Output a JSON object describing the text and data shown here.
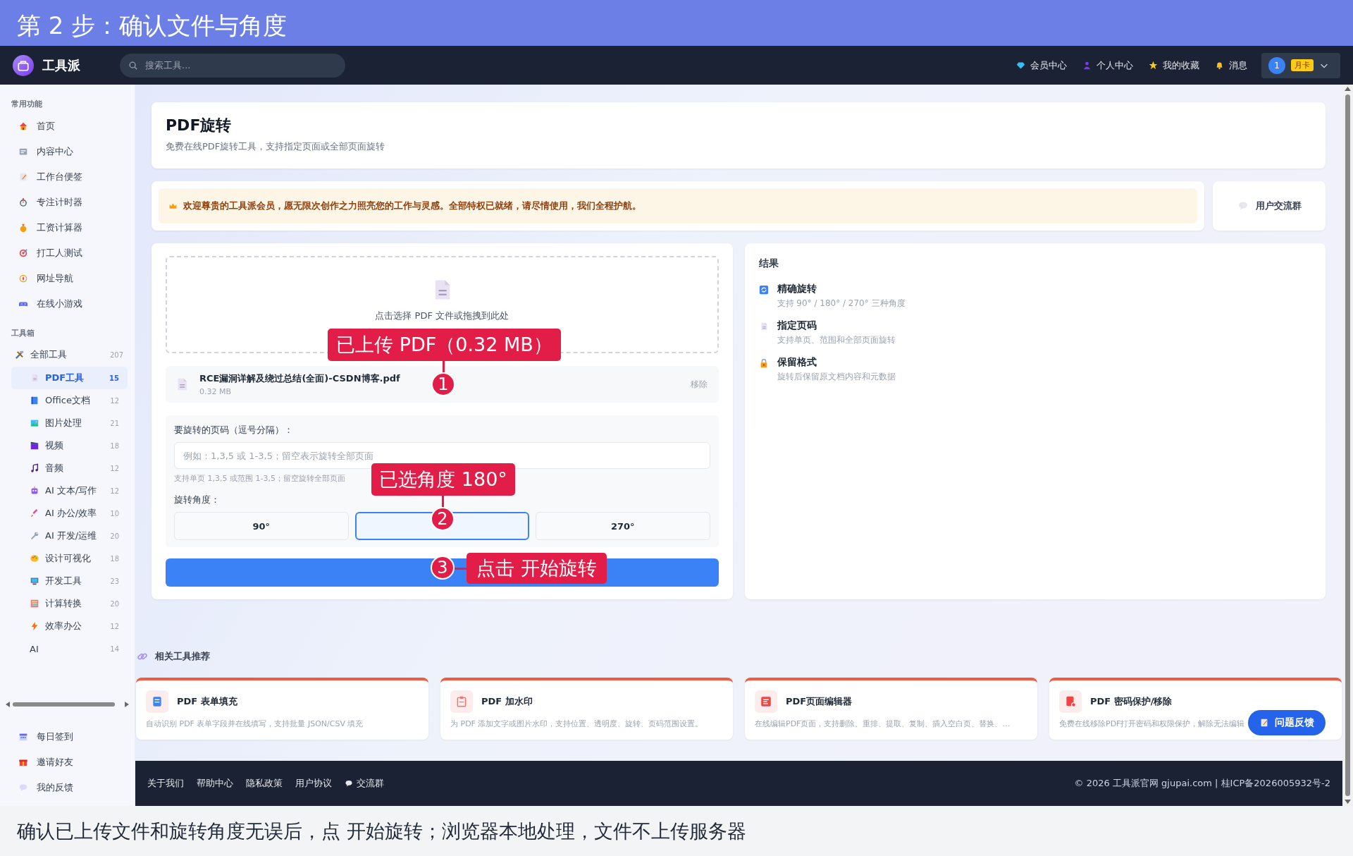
{
  "step_banner": {
    "title": "第 2 步：确认文件与角度"
  },
  "header": {
    "brand": "工具派",
    "search": {
      "placeholder": "搜索工具..."
    },
    "nav": [
      {
        "label": "会员中心"
      },
      {
        "label": "个人中心"
      },
      {
        "label": "我的收藏"
      },
      {
        "label": "消息"
      }
    ],
    "user": {
      "avatar": "1",
      "badge": "月卡"
    }
  },
  "sidebar": {
    "sections": [
      {
        "title": "常用功能",
        "items": [
          {
            "label": "首页",
            "selected": false
          },
          {
            "label": "内容中心",
            "selected": false
          },
          {
            "label": "工作台便签",
            "selected": false
          },
          {
            "label": "专注计时器",
            "selected": false
          },
          {
            "label": "工资计算器",
            "selected": false
          },
          {
            "label": "打工人测试",
            "selected": false
          },
          {
            "label": "网址导航",
            "selected": false
          },
          {
            "label": "在线小游戏",
            "selected": false
          }
        ]
      },
      {
        "title": "工具箱",
        "items": [
          {
            "label": "全部工具",
            "count": "207",
            "children": [
              {
                "label": "PDF工具",
                "count": "15",
                "selected": true
              },
              {
                "label": "Office文档",
                "count": "12",
                "selected": false
              },
              {
                "label": "图片处理",
                "count": "21",
                "selected": false
              },
              {
                "label": "视频",
                "count": "18",
                "selected": false
              },
              {
                "label": "音频",
                "count": "12",
                "selected": false
              },
              {
                "label": "AI 文本/写作",
                "count": "12",
                "selected": false
              },
              {
                "label": "AI 办公/效率",
                "count": "10",
                "selected": false
              },
              {
                "label": "AI 开发/运维",
                "count": "20",
                "selected": false
              },
              {
                "label": "设计可视化",
                "count": "18",
                "selected": false
              },
              {
                "label": "开发工具",
                "count": "23",
                "selected": false
              },
              {
                "label": "计算转换",
                "count": "20",
                "selected": false
              },
              {
                "label": "效率办公",
                "count": "12",
                "selected": false
              },
              {
                "label": "AI",
                "count": "14",
                "selected": false
              }
            ]
          }
        ]
      }
    ],
    "bottom_items": [
      {
        "label": "每日签到",
        "selected": false
      },
      {
        "label": "邀请好友",
        "selected": false
      },
      {
        "label": "我的反馈",
        "selected": false
      }
    ]
  },
  "page_header": {
    "title": "PDF旋转",
    "subtitle": "免费在线PDF旋转工具，支持指定页面或全部页面旋转"
  },
  "notice": {
    "text": "欢迎尊贵的工具派会员，愿无限次创作之力照亮您的工作与灵感。全部特权已就绪，请尽情使用，我们全程护航。",
    "group_button": "用户交流群"
  },
  "upload": {
    "dropzone_text": "点击选择 PDF 文件或拖拽到此处",
    "file": {
      "name": "RCE漏洞详解及绕过总结(全面)-CSDN博客.pdf",
      "size": "0.32 MB",
      "remove": "移除"
    },
    "pages_label": "要旋转的页码（逗号分隔）：",
    "pages_field": {
      "placeholder": "例如：1,3,5 或 1-3,5；留空表示旋转全部页面"
    },
    "pages_hint": "支持单页 1,3,5 或范围 1-3,5；留空旋转全部页面",
    "angle_label": "旋转角度：",
    "angles": [
      {
        "label": "90°",
        "selected": false
      },
      {
        "selected": true
      },
      {
        "label": "270°",
        "selected": false
      }
    ]
  },
  "results": {
    "title": "结果",
    "features": [
      {
        "title": "精确旋转",
        "desc": "支持 90° / 180° / 270° 三种角度"
      },
      {
        "title": "指定页码",
        "desc": "支持单页、范围和全部页面旋转"
      },
      {
        "title": "保留格式",
        "desc": "旋转后保留原文档内容和元数据"
      }
    ]
  },
  "related": {
    "title": "相关工具推荐",
    "cards": [
      {
        "title": "PDF 表单填充",
        "desc": "自动识别 PDF 表单字段并在线填写，支持批量 JSON/CSV 填充"
      },
      {
        "title": "PDF 加水印",
        "desc": "为 PDF 添加文字或图片水印，支持位置、透明度、旋转、页码范围设置。"
      },
      {
        "title": "PDF页面编辑器",
        "desc": "在线编辑PDF页面，支持删除、重排、提取、复制、插入空白页、替换、…"
      },
      {
        "title": "PDF 密码保护/移除",
        "desc": "免费在线移除PDF打开密码和权限保护，解除无法编辑"
      }
    ]
  },
  "feedback_button": "问题反馈",
  "footer": {
    "links": [
      {
        "label": "关于我们"
      },
      {
        "label": "帮助中心"
      },
      {
        "label": "隐私政策"
      },
      {
        "label": "用户协议"
      },
      {
        "label": "交流群"
      }
    ],
    "copyright": "© 2026 工具派官网 gjupai.com | 桂ICP备2026005932号-2"
  },
  "callouts": [
    {
      "number": "1",
      "text": "已上传 PDF（0.32 MB）"
    },
    {
      "number": "2",
      "text": "已选角度 180°"
    },
    {
      "number": "3",
      "text": "点击 开始旋转"
    }
  ],
  "caption": "确认已上传文件和旋转角度无误后，点 开始旋转；浏览器本地处理，文件不上传服务器"
}
